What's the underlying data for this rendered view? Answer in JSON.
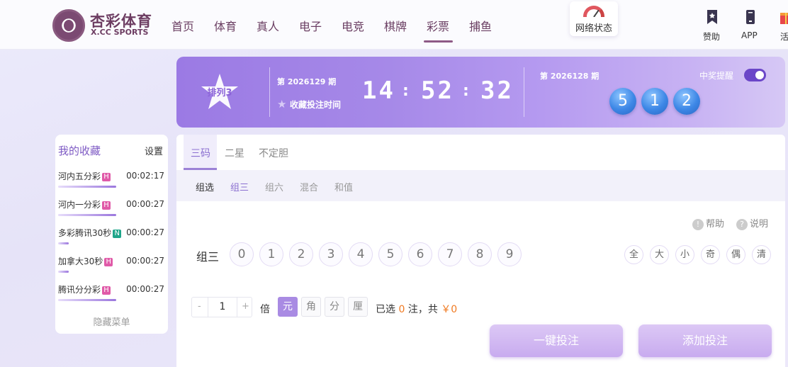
{
  "header": {
    "logo_cn": "杏彩体育",
    "logo_en": "X.CC SPORTS",
    "nav": [
      "首页",
      "体育",
      "真人",
      "电子",
      "电竞",
      "棋牌",
      "彩票",
      "捕鱼"
    ],
    "active_nav": "彩票",
    "network_label": "网络状态",
    "right_items": [
      {
        "label": "赞助",
        "icon": "bookmark-icon"
      },
      {
        "label": "APP",
        "icon": "phone-icon"
      },
      {
        "label": "活",
        "icon": "gift-icon"
      }
    ]
  },
  "banner": {
    "logo_text": "排列3",
    "current_issue": "第 2026129 期",
    "favorite_label": "收藏投注时间",
    "countdown": {
      "h": "14",
      "m": "52",
      "s": "32"
    },
    "last_issue": "第 2026128 期",
    "remind_label": "中奖提醒",
    "remind_on": true,
    "result_balls": [
      "5",
      "1",
      "2"
    ]
  },
  "favorites": {
    "title": "我的收藏",
    "settings_label": "设置",
    "items": [
      {
        "name": "河内五分彩",
        "badge": "H",
        "badge_color": "#e05aa8",
        "time": "00:02:17",
        "progress": 0.55
      },
      {
        "name": "河内一分彩",
        "badge": "H",
        "badge_color": "#e05aa8",
        "time": "00:00:27",
        "progress": 0.55
      },
      {
        "name": "多彩腾讯30秒",
        "badge": "N",
        "badge_color": "#1fa58a",
        "time": "00:00:27",
        "progress": 0.1
      },
      {
        "name": "加拿大30秒",
        "badge": "H",
        "badge_color": "#e05aa8",
        "time": "00:00:27",
        "progress": 0.1
      },
      {
        "name": "腾讯分分彩",
        "badge": "H",
        "badge_color": "#e05aa8",
        "time": "00:00:27",
        "progress": 0.55
      }
    ],
    "hide_label": "隐藏菜单"
  },
  "main": {
    "tabs": [
      "三码",
      "二星",
      "不定胆"
    ],
    "active_tab": "三码",
    "subtabs": [
      "组选",
      "组三",
      "组六",
      "混合",
      "和值"
    ],
    "help_label": "帮助",
    "explain_label": "说明",
    "row_label": "组三",
    "numbers": [
      "0",
      "1",
      "2",
      "3",
      "4",
      "5",
      "6",
      "7",
      "8",
      "9"
    ],
    "quick_select": [
      "全",
      "大",
      "小",
      "奇",
      "偶",
      "清"
    ],
    "multiplier": {
      "minus": "-",
      "value": "1",
      "plus": "+",
      "label": "倍"
    },
    "units": [
      "元",
      "角",
      "分",
      "厘"
    ],
    "active_unit": "元",
    "summary": {
      "prefix": "已选 ",
      "count": "0",
      "mid": " 注，共 ",
      "amount": "￥0"
    },
    "buttons": {
      "quick_bet": "一键投注",
      "add_bet": "添加投注"
    }
  },
  "colors": {
    "accent": "#9c82d6",
    "brand": "#6d3d62",
    "highlight": "#f07a22"
  }
}
